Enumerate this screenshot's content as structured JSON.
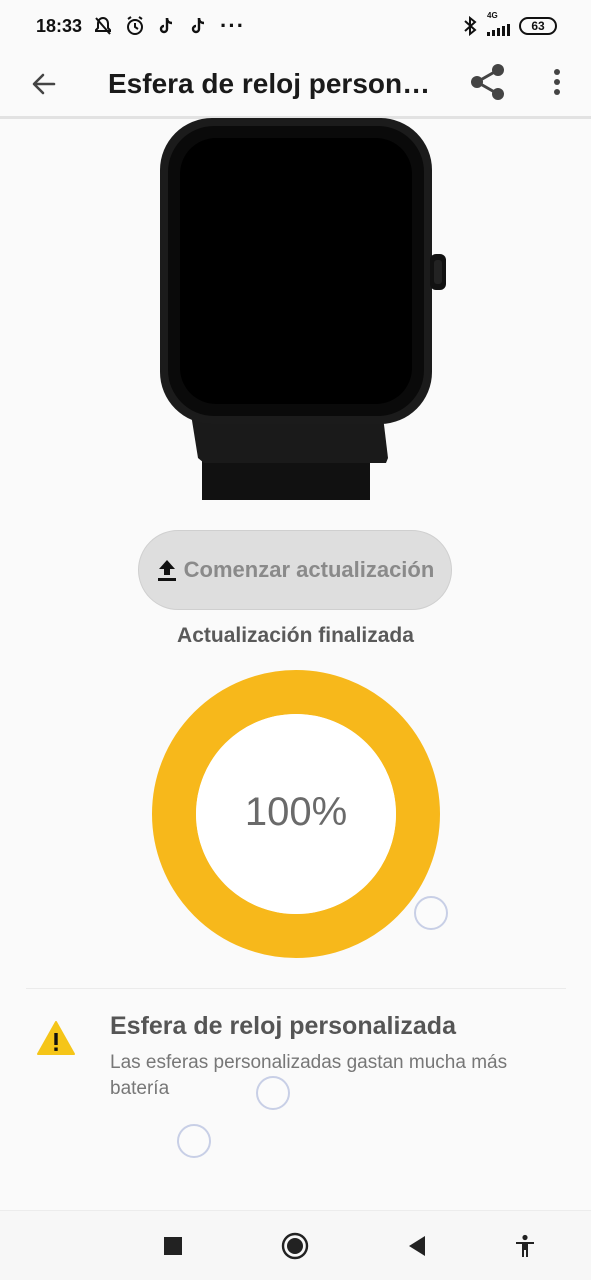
{
  "status_bar": {
    "time": "18:33",
    "dots": "···",
    "network": "4G",
    "battery": "63",
    "icons": [
      "notifications-off-icon",
      "alarm-icon",
      "tiktok-icon",
      "tiktok-icon",
      "bluetooth-icon",
      "signal-icon",
      "battery-icon"
    ]
  },
  "app_bar": {
    "title": "Esfera de reloj person…",
    "icons": [
      "back-arrow-icon",
      "share-icon",
      "more-vertical-icon"
    ]
  },
  "main": {
    "update_button_label": "Comenzar actualización",
    "update_icon": "upload-icon",
    "status": "Actualización finalizada",
    "progress": {
      "value": 100,
      "label": "100%",
      "color": "#F7B81B",
      "track_color": "#ffffff"
    }
  },
  "warning": {
    "icon": "warning-icon",
    "icon_color": "#F5C518",
    "title": "Esfera de reloj personalizada",
    "description": "Las esferas personalizadas gastan mucha más batería"
  },
  "nav_bar": {
    "icons": [
      "recents-square-icon",
      "home-circle-icon",
      "back-triangle-icon",
      "accessibility-icon"
    ]
  }
}
